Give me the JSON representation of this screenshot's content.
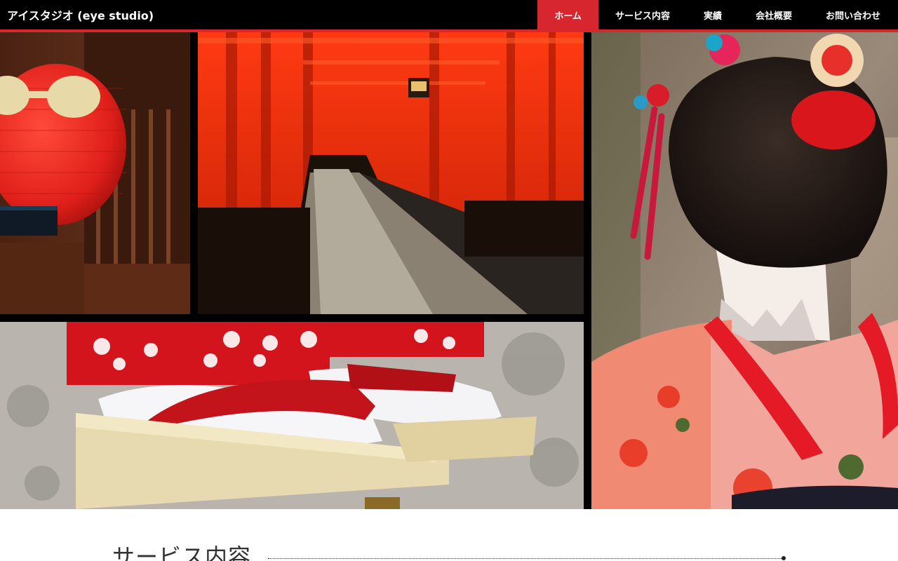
{
  "header": {
    "logo": "アイスタジオ (eye studio)",
    "nav": [
      {
        "label": "ホーム",
        "active": true
      },
      {
        "label": "サービス内容",
        "active": false
      },
      {
        "label": "実績",
        "active": false
      },
      {
        "label": "会社概要",
        "active": false
      },
      {
        "label": "お問い合わせ",
        "active": false
      }
    ]
  },
  "hero": {
    "images": [
      {
        "name": "lantern-photo"
      },
      {
        "name": "torii-gates-photo"
      },
      {
        "name": "geta-sandals-photo"
      },
      {
        "name": "maiko-photo"
      }
    ]
  },
  "section": {
    "title": "サービス内容"
  },
  "colors": {
    "header_bg": "#000000",
    "accent": "#d7262e",
    "text": "#333333"
  }
}
